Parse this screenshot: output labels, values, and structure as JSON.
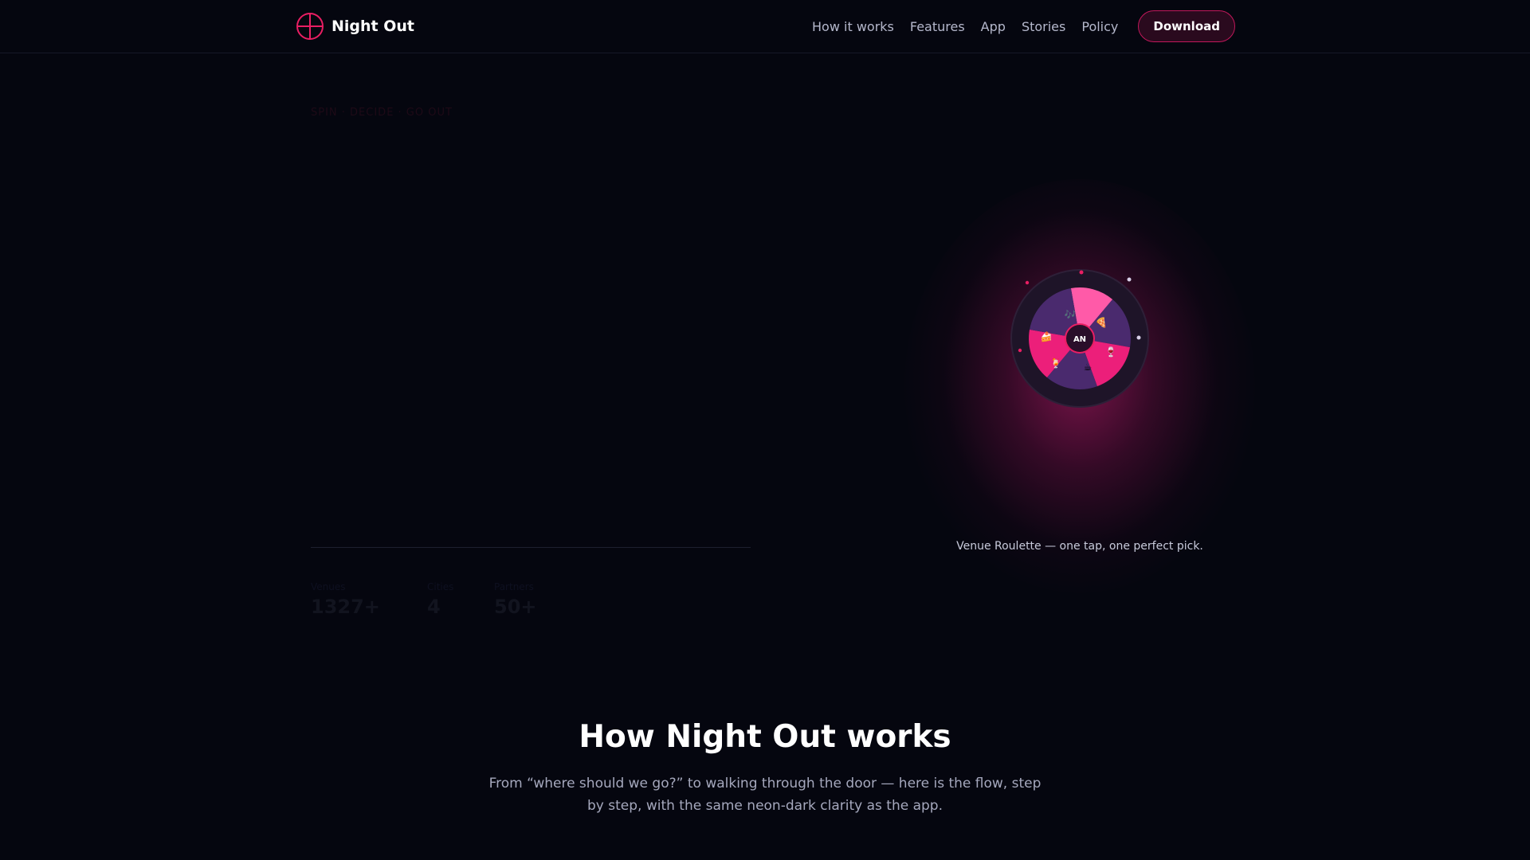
{
  "nav": {
    "brand": "Night Out",
    "links": [
      "How it works",
      "Features",
      "App",
      "Stories",
      "Policy"
    ],
    "download_label": "Download"
  },
  "hero": {
    "eyebrow": "SPIN · DECIDE · GO OUT",
    "stats": [
      {
        "label": "Venues",
        "value": "1327+"
      },
      {
        "label": "Cities",
        "value": "4"
      },
      {
        "label": "Partners",
        "value": "50+"
      }
    ],
    "wheel": {
      "center_label": "AN",
      "segment_icons": [
        "🎶",
        "🍕",
        "🍷",
        "☕",
        "🍹",
        "🍰"
      ]
    },
    "caption": "Venue Roulette — one tap, one perfect pick."
  },
  "how": {
    "title": "How Night Out works",
    "description": "From “where should we go?” to walking through the door — here is the flow, step by step, with the same neon-dark clarity as the app."
  },
  "colors": {
    "background": "#05060f",
    "accent": "#e91e63",
    "accent_light": "#ff4fa0",
    "segment_dark": "#4a2a6e"
  },
  "icons": {
    "brand": "crosshair-circle-icon"
  }
}
